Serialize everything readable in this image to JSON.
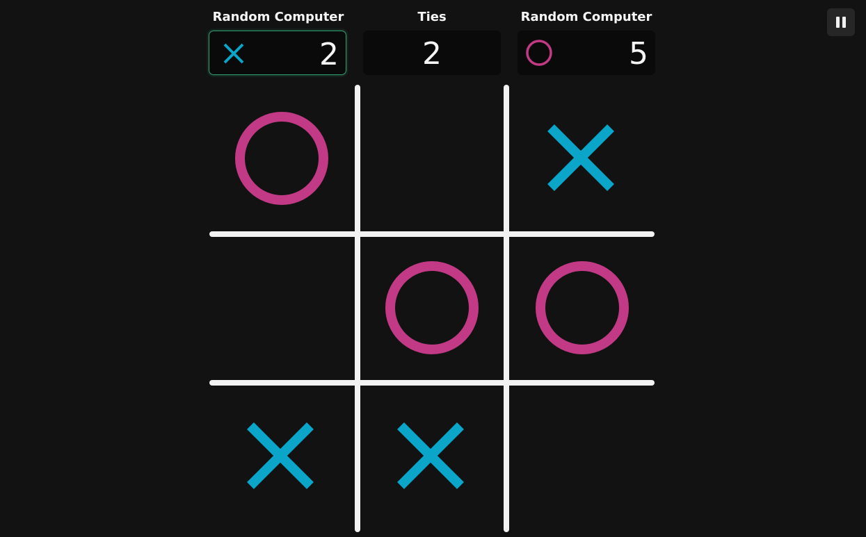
{
  "players": {
    "x": {
      "name": "Random Computer",
      "score": "2",
      "icon": "x-mark-icon",
      "color": "#0aa5c9"
    },
    "ties": {
      "name": "Ties",
      "score": "2"
    },
    "o": {
      "name": "Random Computer",
      "score": "5",
      "icon": "o-mark-icon",
      "color": "#c23a86"
    }
  },
  "active_player": "x",
  "controls": {
    "pause_icon": "pause-icon"
  },
  "board": {
    "cells": [
      "O",
      "",
      "X",
      "",
      "O",
      "O",
      "X",
      "X",
      ""
    ],
    "grid_color": "#f2f2f2"
  }
}
